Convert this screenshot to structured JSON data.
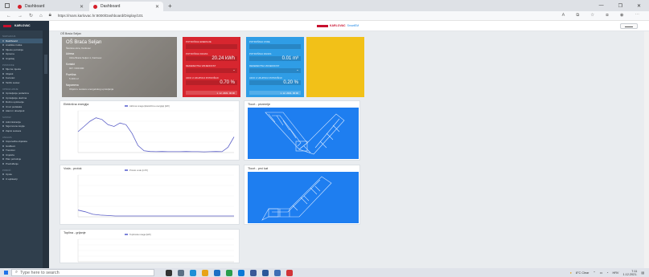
{
  "browser": {
    "tabs": [
      {
        "label": "Dashboard",
        "active": false
      },
      {
        "label": "Dashboard",
        "active": true
      }
    ],
    "new_tab": "+",
    "window_controls": [
      "—",
      "❐",
      "✕"
    ],
    "url": "https://mars.karlovac.hr:8000/Dashboard/Display/101"
  },
  "header": {
    "brand": "KARLOVAC",
    "app_name": "SmartEM"
  },
  "sidebar": {
    "brand": "KARLOVAC",
    "sections": [
      {
        "title": "Navigacija",
        "items": [
          "Dashboard",
          "Analitika troška",
          "Mjesto potrošnje",
          "Oprema",
          "Izvještaj"
        ]
      },
      {
        "title": "Postavke",
        "items": [
          "Mjerna mjesta",
          "Objekti",
          "Korisnici",
          "Tarifni sustav"
        ]
      },
      {
        "title": "Upravljanje",
        "items": [
          "Upravljanje podacima",
          "Upravljanje ulazima",
          "Ručno upisivanje",
          "Izvoz podataka",
          "Alarmi i obavijesti"
        ]
      },
      {
        "title": "Sustav",
        "items": [
          "Administracija",
          "Sigurnosne kopije",
          "Zapisi sustava"
        ]
      },
      {
        "title": "Analiza",
        "items": [
          "Usporedba objekata",
          "Grafikoni",
          "Trendovi",
          "Izvješća",
          "Plan potrošnje",
          "Predviđanje"
        ]
      },
      {
        "title": "Pomoć",
        "items": [
          "Upute",
          "O aplikaciji"
        ]
      }
    ]
  },
  "breadcrumb": "OŠ Braća Seljan",
  "photo": {
    "title": "OŠ Braća Seljan",
    "subtitle": "Školska ulica, Karlovac",
    "rows": [
      {
        "label": "Adresa",
        "value": "Ulica Braća Seljan 1, Karlovac"
      },
      {
        "label": "Kontakt",
        "value": "047 / 000 000"
      },
      {
        "label": "Površina",
        "value": "5 400 m²"
      },
      {
        "label": "Napomena",
        "value": "Objekt u sustavu energetskog upravljanja"
      }
    ]
  },
  "stats": [
    {
      "color": "#d7262f",
      "rows": [
        {
          "label": "POTROŠNJA ENERGIJE",
          "value": ""
        },
        {
          "label": "POTROŠNJA DANAS",
          "value": "20.24 kWh"
        },
        {
          "label": "REFERENTNA VRIJEDNOST",
          "value": "-"
        },
        {
          "label": "UDIO U UKUPNOJ POTROŠNJI",
          "value": "0.70 %"
        }
      ],
      "footer": "1. 12. 2021. 00:00"
    },
    {
      "color": "#2f9de6",
      "rows": [
        {
          "label": "POTROŠNJA VODE",
          "value": ""
        },
        {
          "label": "POTROŠNJA DANAS",
          "value": "0.01 m³"
        },
        {
          "label": "REFERENTNA VRIJEDNOST",
          "value": "-"
        },
        {
          "label": "UDIO U UKUPNOJ POTROŠNJI",
          "value": "0.20 %"
        }
      ],
      "footer": "1. 12. 2021. 00:00"
    },
    {
      "color": "#f2c118",
      "rows": [],
      "footer": ""
    }
  ],
  "charts": [
    {
      "title": "Električna energija",
      "legend": "Aktivna snaga (Električna energija) [kW]"
    },
    {
      "title": "Voda - protok",
      "legend": "Protok vode [m³/h]"
    },
    {
      "title": "Toplina - grijanje",
      "legend": "Toplinska snaga [kW]"
    }
  ],
  "floorplans": [
    {
      "title": "Tlocrt - prizemlje"
    },
    {
      "title": "Tlocrt - prvi kat"
    }
  ],
  "chart_data": [
    {
      "type": "line",
      "title": "Električna energija",
      "series": [
        {
          "name": "Aktivna snaga (Električna energija) [kW]",
          "values": [
            12,
            15,
            18,
            20,
            19,
            16,
            15,
            17,
            16,
            11,
            4,
            1,
            0.6,
            0.5,
            0.6,
            0.5,
            0.5,
            0.5,
            0.6,
            0.5,
            0.5,
            0.4,
            0.5,
            0.6,
            0.5,
            3,
            9
          ]
        }
      ],
      "ylim": [
        0,
        24
      ]
    },
    {
      "type": "line",
      "title": "Voda - protok",
      "series": [
        {
          "name": "Protok vode [m³/h]",
          "values": [
            0.8,
            0.6,
            0.3,
            0.2,
            0.15,
            0.1,
            0.1,
            0.1,
            0.1,
            0.1,
            0.1,
            0.1,
            0.1,
            0.1,
            0.1,
            0.1,
            0.1,
            0.1,
            0.1,
            0.1,
            0.1,
            0.1
          ]
        }
      ],
      "ylim": [
        0,
        5
      ]
    },
    {
      "type": "line",
      "title": "Toplina - grijanje",
      "series": [
        {
          "name": "Toplinska snaga [kW]",
          "values": []
        }
      ],
      "ylim": [
        0,
        10
      ]
    }
  ],
  "taskbar": {
    "search_placeholder": "Type here to search",
    "weather": "8°C Clear",
    "language": "HRV",
    "time": "7:11",
    "date": "1.12.2021."
  },
  "colors": {
    "sidebar": "#2f3e4c",
    "accent_red": "#d7262f",
    "accent_blue": "#2f9de6",
    "accent_yellow": "#f2c118",
    "plan_blue": "#1e7ef0"
  }
}
